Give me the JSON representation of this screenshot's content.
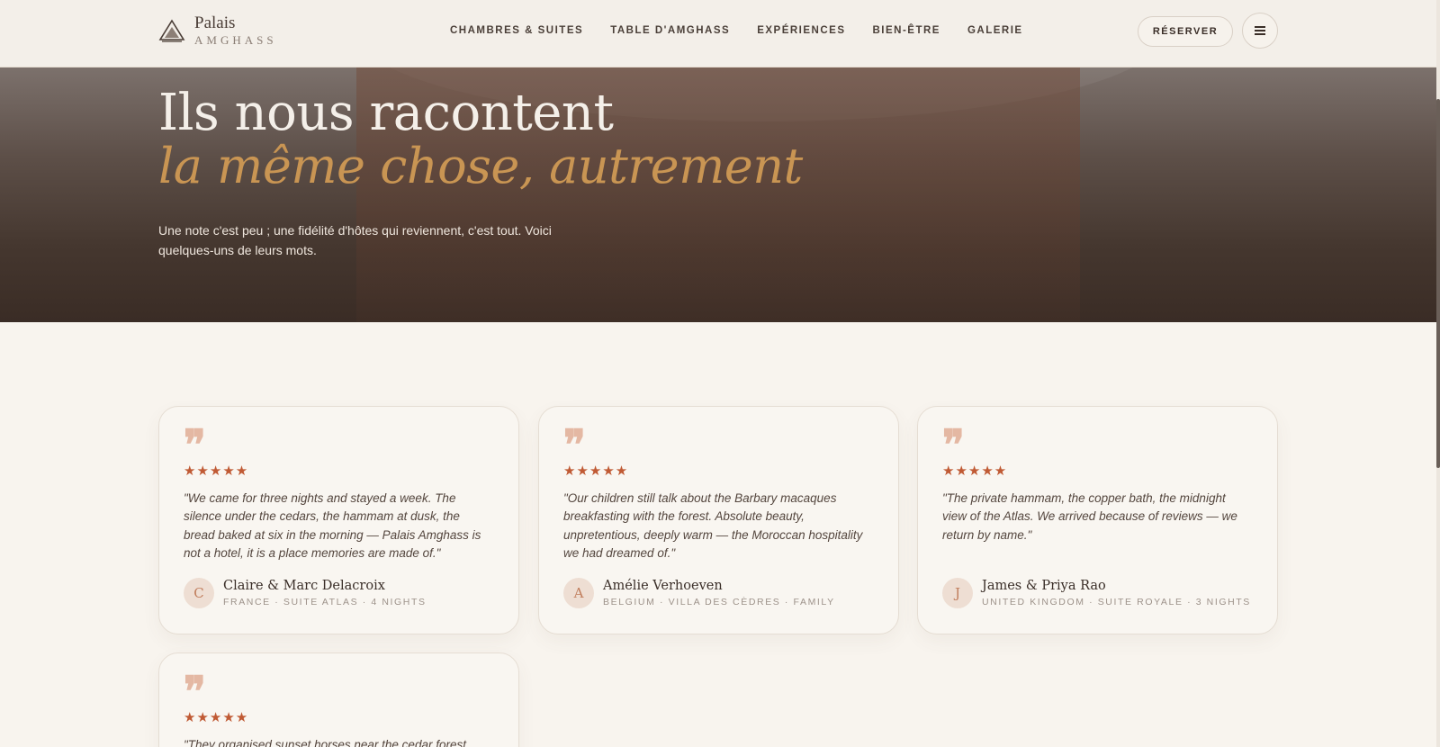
{
  "brand": {
    "line1": "Palais",
    "line2": "AMGHASS"
  },
  "nav": [
    {
      "label": "CHAMBRES & SUITES"
    },
    {
      "label": "TABLE D'AMGHASS"
    },
    {
      "label": "EXPÉRIENCES"
    },
    {
      "label": "BIEN-ÊTRE"
    },
    {
      "label": "GALERIE"
    }
  ],
  "header": {
    "reserve_label": "RÉSERVER",
    "menu_icon": "hamburger-icon"
  },
  "hero": {
    "title": "Ils nous racontent",
    "subtitle": "la même chose, autrement",
    "description": "Une note c'est peu ; une fidélité d'hôtes qui reviennent, c'est tout. Voici quelques-uns de leurs mots."
  },
  "reviews": [
    {
      "quote_icon": "quote-icon",
      "stars": "★★★★★",
      "text": "\"We came for three nights and stayed a week. The silence under the cedars, the hammam at dusk, the bread baked at six in the morning — Palais Amghass is not a hotel, it is a place memories are made of.\"",
      "initial": "C",
      "name": "Claire & Marc Delacroix",
      "meta": "FRANCE · SUITE ATLAS · 4 NIGHTS"
    },
    {
      "quote_icon": "quote-icon",
      "stars": "★★★★★",
      "text": "\"Our children still talk about the Barbary macaques breakfasting with the forest. Absolute beauty, unpretentious, deeply warm — the Moroccan hospitality we had dreamed of.\"",
      "initial": "A",
      "name": "Amélie Verhoeven",
      "meta": "BELGIUM · VILLA DES CÈDRES · FAMILY"
    },
    {
      "quote_icon": "quote-icon",
      "stars": "★★★★★",
      "text": "\"The private hammam, the copper bath, the midnight view of the Atlas. We arrived because of reviews — we return by name.\"",
      "initial": "J",
      "name": "James & Priya Rao",
      "meta": "UNITED KINGDOM · SUITE ROYALE · 3 NIGHTS"
    },
    {
      "quote_icon": "quote-icon",
      "stars": "★★★★★",
      "text": "\"They organised sunset horses near the cedar forest,"
    }
  ],
  "colors": {
    "accent_gold": "#c99553",
    "star_color": "#c05a34",
    "background": "#f8f4ee"
  }
}
